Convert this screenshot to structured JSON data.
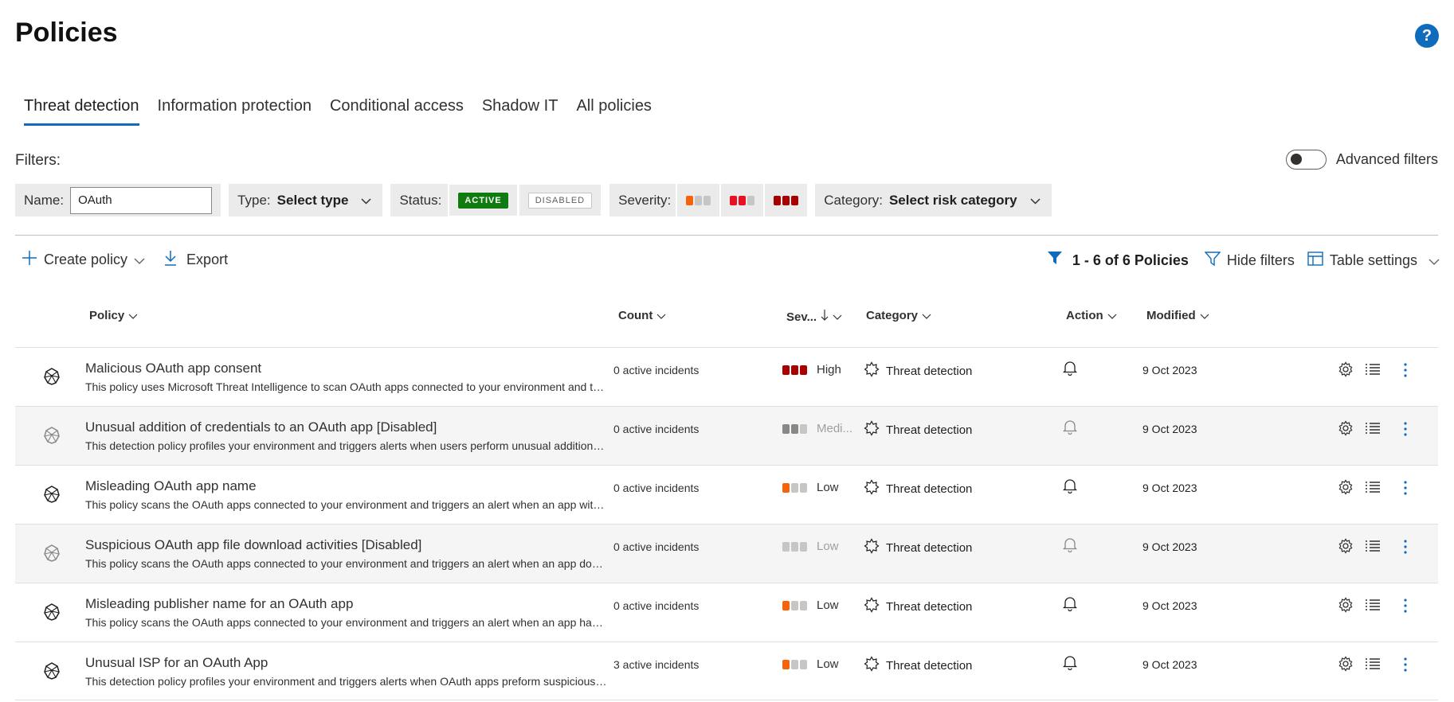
{
  "page": {
    "title": "Policies",
    "help_label": "?"
  },
  "tabs": [
    {
      "label": "Threat detection",
      "active": true
    },
    {
      "label": "Information protection"
    },
    {
      "label": "Conditional access"
    },
    {
      "label": "Shadow IT"
    },
    {
      "label": "All policies"
    }
  ],
  "filters": {
    "label": "Filters:",
    "advanced_label": "Advanced filters",
    "name_label": "Name:",
    "name_value": "OAuth",
    "type_label": "Type:",
    "type_value": "Select type",
    "status_label": "Status:",
    "status_active": "ACTIVE",
    "status_disabled": "DISABLED",
    "severity_label": "Severity:",
    "category_label": "Category:",
    "category_value": "Select risk category"
  },
  "toolbar": {
    "create_label": "Create policy",
    "export_label": "Export",
    "count_text": "1 - 6 of 6 Policies",
    "hide_filters_label": "Hide filters",
    "table_settings_label": "Table settings"
  },
  "columns": {
    "policy": "Policy",
    "count": "Count",
    "severity": "Sev...",
    "category": "Category",
    "action": "Action",
    "modified": "Modified"
  },
  "colors": {
    "accent": "#0f6cbd",
    "active_green": "#107c10",
    "sev_low": "#f7630c",
    "sev_medium": "#e81123",
    "sev_high": "#a80000",
    "sev_grey": "#8a8886",
    "sev_empty": "#c8c6c4"
  },
  "rows": [
    {
      "name": "Malicious OAuth app consent",
      "description": "This policy uses Microsoft Threat Intelligence to scan OAuth apps connected to your environment and triggers an alert when a potentially malicious app is found.",
      "count": "0 active incidents",
      "severity": "High",
      "category": "Threat detection",
      "modified": "9 Oct 2023",
      "disabled": false
    },
    {
      "name": "Unusual addition of credentials to an OAuth app [Disabled]",
      "description": "This detection policy profiles your environment and triggers alerts when users perform unusual addition of credentials to an OAuth app.",
      "count": "0 active incidents",
      "severity": "Medium",
      "severity_label": "Medi...",
      "category": "Threat detection",
      "modified": "9 Oct 2023",
      "disabled": true
    },
    {
      "name": "Misleading OAuth app name",
      "description": "This policy scans the OAuth apps connected to your environment and triggers an alert when an app with a misleading name is found.",
      "count": "0 active incidents",
      "severity": "Low",
      "category": "Threat detection",
      "modified": "9 Oct 2023",
      "disabled": false
    },
    {
      "name": "Suspicious OAuth app file download activities [Disabled]",
      "description": "This policy scans the OAuth apps connected to your environment and triggers an alert when an app downloads multiple files.",
      "count": "0 active incidents",
      "severity": "Low",
      "category": "Threat detection",
      "modified": "9 Oct 2023",
      "disabled": true
    },
    {
      "name": "Misleading publisher name for an OAuth app",
      "description": "This policy scans the OAuth apps connected to your environment and triggers an alert when an app has a misleading publisher name.",
      "count": "0 active incidents",
      "severity": "Low",
      "category": "Threat detection",
      "modified": "9 Oct 2023",
      "disabled": false
    },
    {
      "name": "Unusual ISP for an OAuth App",
      "description": "This detection policy profiles your environment and triggers alerts when OAuth apps preform suspicious activities from an uncommon ISP.",
      "count": "3 active incidents",
      "severity": "Low",
      "category": "Threat detection",
      "modified": "9 Oct 2023",
      "disabled": false
    }
  ]
}
